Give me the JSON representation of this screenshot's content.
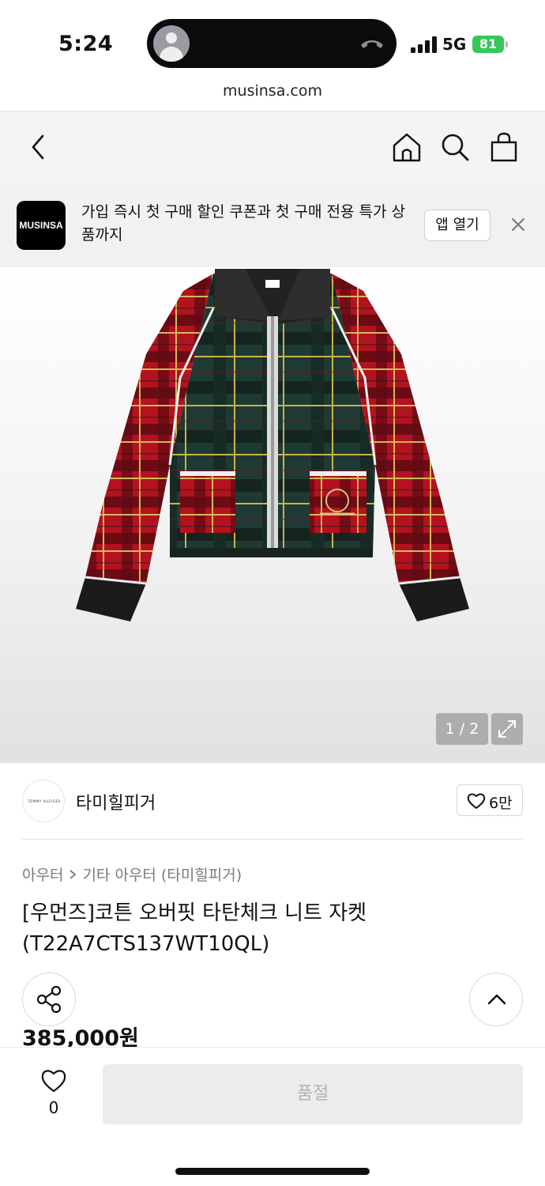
{
  "status_bar": {
    "time": "5:24",
    "network": "5G",
    "battery": "81"
  },
  "browser": {
    "url": "musinsa.com"
  },
  "nav": {
    "icons": [
      "back-icon",
      "home-icon",
      "search-icon",
      "shopping-bag-icon"
    ]
  },
  "banner": {
    "logo": "MUSINSA",
    "text": "가입 즉시 첫 구매 할인 쿠폰과 첫 구매 전용 특가 상품까지",
    "open_app": "앱 열기"
  },
  "gallery": {
    "pager": "1 / 2"
  },
  "brand": {
    "logo_text": "TOMMY HILFIGER",
    "name": "타미힐피거",
    "likes": "6만"
  },
  "product": {
    "breadcrumb_category": "아우터",
    "breadcrumb_sub": "기타 아우터 (타미힐피거)",
    "title": "[우먼즈]코튼 오버핏 타탄체크 니트 자켓 (T22A7CTS137WT10QL)",
    "price": "385,000원"
  },
  "bottom_bar": {
    "wish_count": "0",
    "buy_label": "품절"
  },
  "colors": {
    "accent_battery": "#34c759",
    "soldout_bg": "#ececec",
    "soldout_text": "#b2b2b2"
  }
}
